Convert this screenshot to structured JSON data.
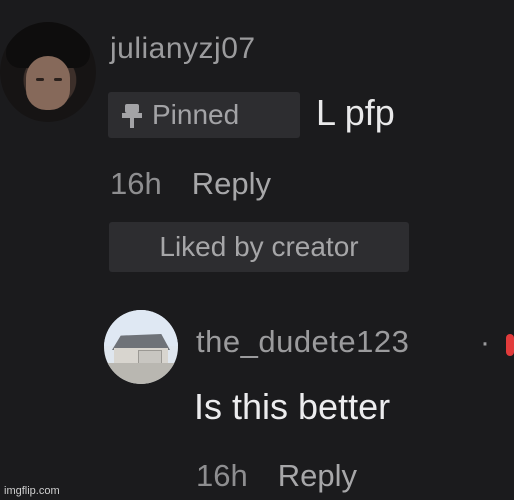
{
  "comment1": {
    "username": "julianyzj07",
    "badge": "Pinned",
    "text": "L pfp",
    "age": "16h",
    "reply_label": "Reply",
    "liked_label": "Liked by creator"
  },
  "comment2": {
    "username": "the_dudete123",
    "separator": "·",
    "text": "Is this better",
    "age": "16h",
    "reply_label": "Reply"
  },
  "watermark": "imgflip.com",
  "icons": {
    "pin": "pin-icon",
    "avatar1": "avatar-icon",
    "avatar2": "avatar-icon"
  }
}
